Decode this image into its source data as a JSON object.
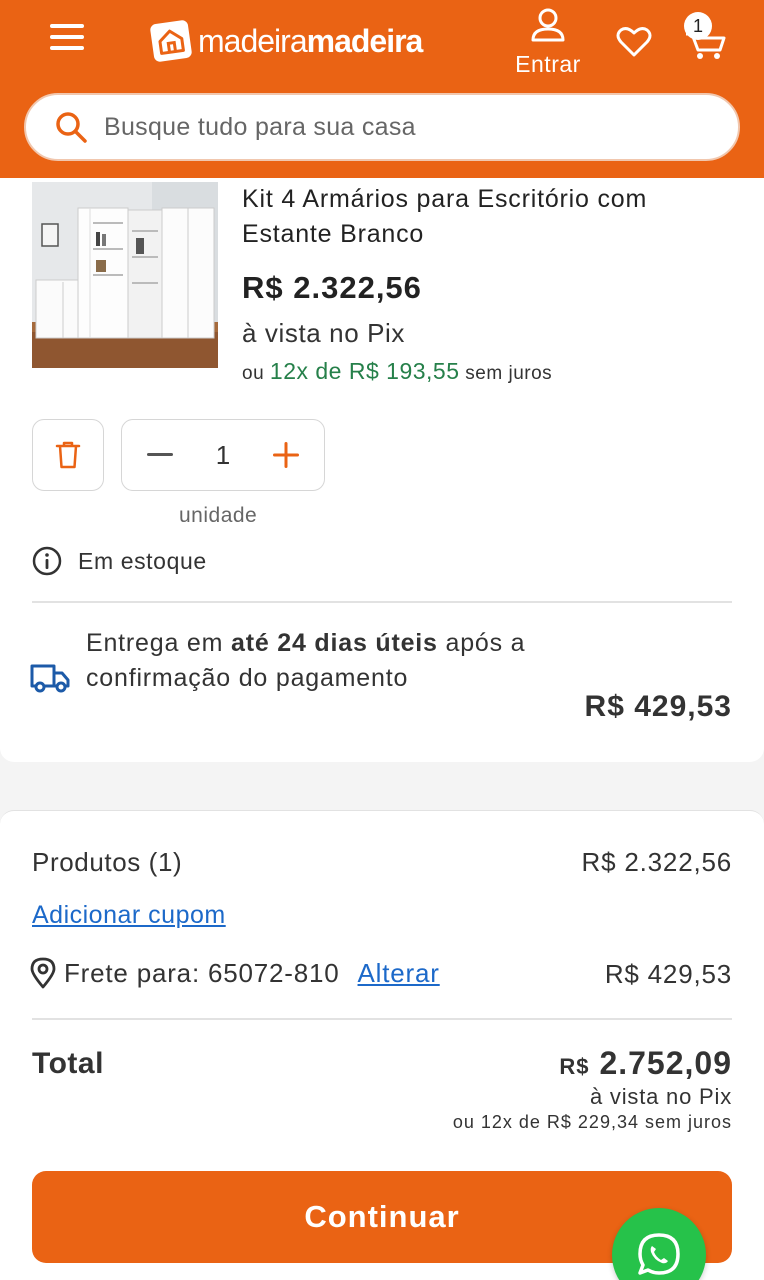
{
  "header": {
    "logo_text_light": "madeira",
    "logo_text_bold": "madeira",
    "login_label": "Entrar",
    "cart_count": "1",
    "search_placeholder": "Busque tudo para sua casa"
  },
  "product": {
    "name": "Kit 4 Armários para Escritório com Estante Branco",
    "price": "R$ 2.322,56",
    "pix_label": "à vista no Pix",
    "installment_prefix": "ou",
    "installment_value": "12x de R$ 193,55",
    "installment_suffix": "sem juros",
    "quantity": "1",
    "unit_label": "unidade",
    "stock_label": "Em estoque"
  },
  "delivery": {
    "text_before": "Entrega em",
    "text_bold": "até 24 dias úteis",
    "text_after": "após a confirmação do pagamento",
    "price": "R$ 429,53"
  },
  "summary": {
    "products_label": "Produtos (1)",
    "products_value": "R$ 2.322,56",
    "coupon_label": "Adicionar cupom",
    "shipping_label": "Frete para: 65072-810",
    "shipping_change": "Alterar",
    "shipping_value": "R$ 429,53",
    "total_label": "Total",
    "total_currency": "R$",
    "total_value": "2.752,09",
    "total_pix": "à vista no Pix",
    "total_installments": "ou 12x de R$ 229,34 sem juros",
    "continue_label": "Continuar"
  },
  "colors": {
    "brand_orange": "#ea6314",
    "link_blue": "#1c69c9",
    "installment_green": "#26804a",
    "whatsapp_green": "#26c24a"
  },
  "icons": [
    "menu-icon",
    "logo-icon",
    "user-icon",
    "heart-icon",
    "cart-icon",
    "search-icon",
    "trash-icon",
    "minus-icon",
    "plus-icon",
    "info-icon",
    "truck-icon",
    "location-pin-icon",
    "whatsapp-icon"
  ]
}
